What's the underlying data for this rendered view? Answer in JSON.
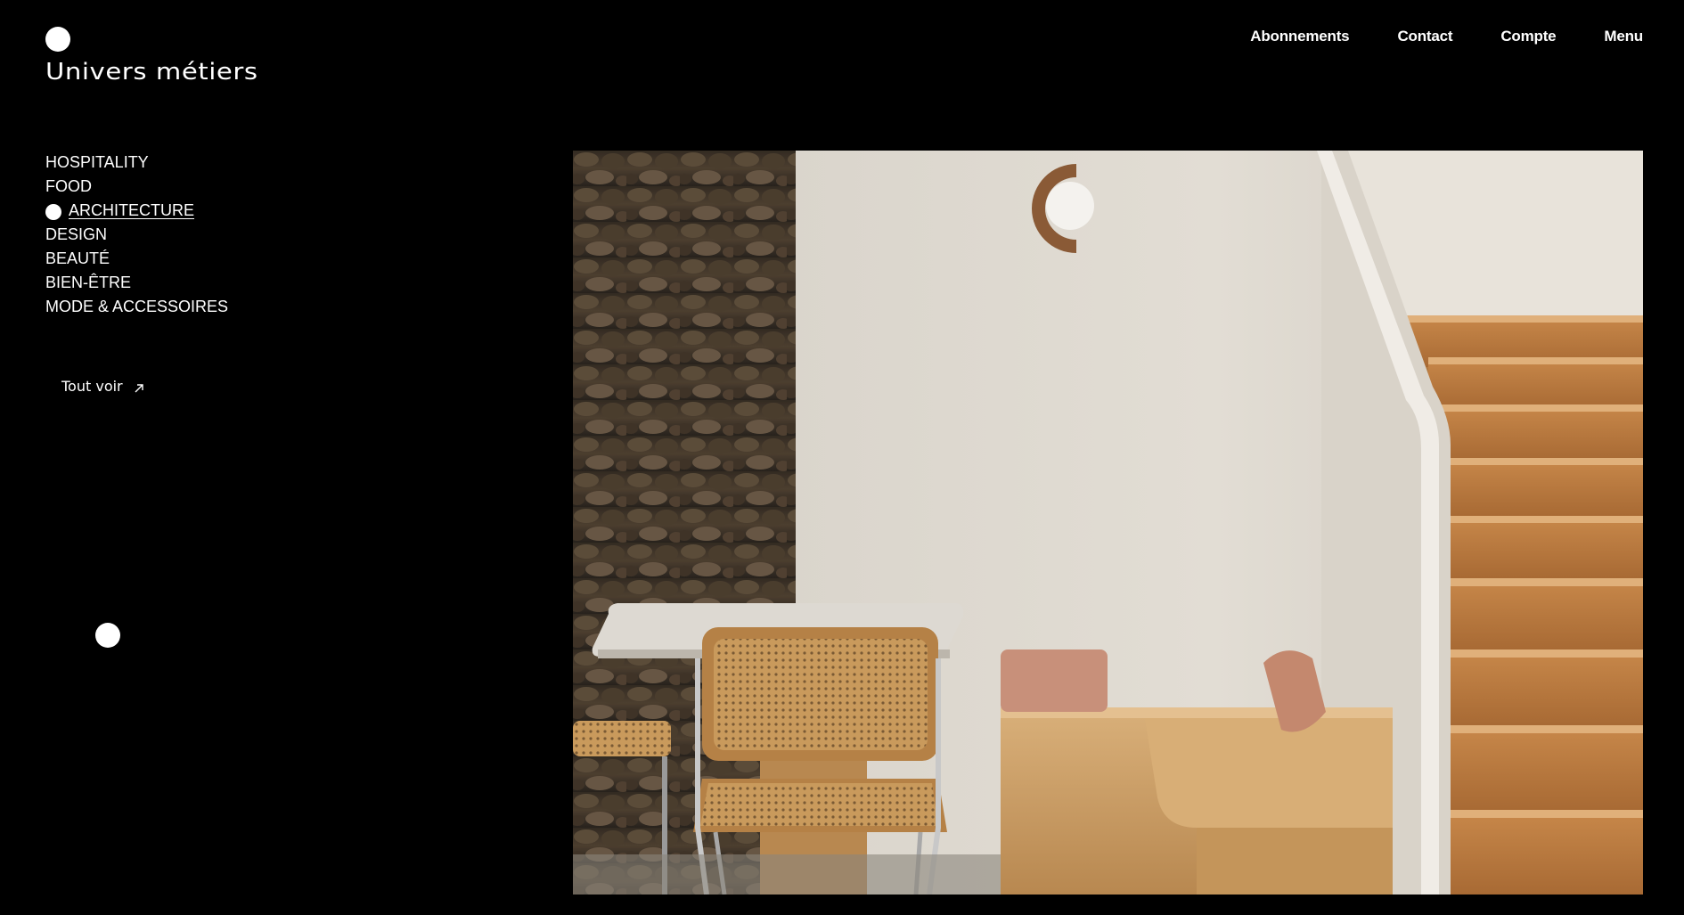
{
  "brand": {
    "name": "Univers métiers"
  },
  "topnav": [
    {
      "label": "Abonnements"
    },
    {
      "label": "Contact"
    },
    {
      "label": "Compte"
    },
    {
      "label": "Menu"
    }
  ],
  "categories": [
    {
      "label": "HOSPITALITY",
      "active": false
    },
    {
      "label": "FOOD",
      "active": false
    },
    {
      "label": "ARCHITECTURE",
      "active": true
    },
    {
      "label": "DESIGN",
      "active": false
    },
    {
      "label": "BEAUTÉ",
      "active": false
    },
    {
      "label": "BIEN-ÊTRE",
      "active": false
    },
    {
      "label": "MODE & ACCESSOIRES",
      "active": false
    }
  ],
  "see_all": {
    "label": "Tout voir",
    "icon": "arrow-up-right-icon"
  },
  "colors": {
    "background": "#000000",
    "text": "#ffffff"
  }
}
